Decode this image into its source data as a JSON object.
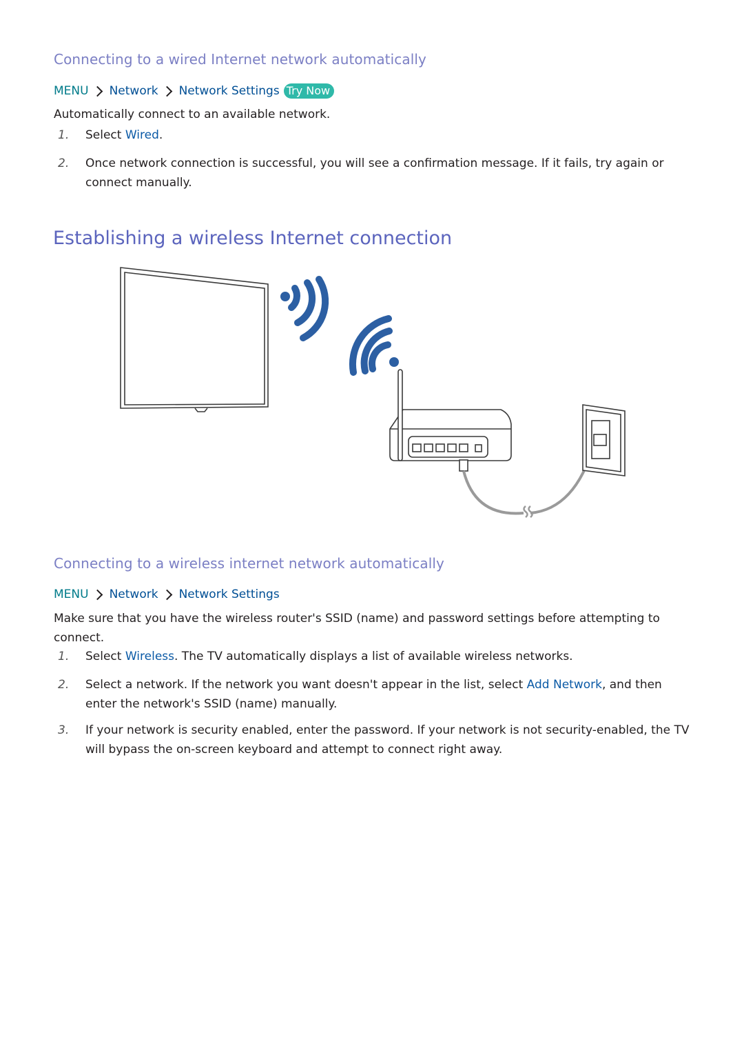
{
  "section_wired": {
    "heading": "Connecting to a wired Internet network automatically",
    "path": {
      "menu": "MENU",
      "crumbs": [
        "Network",
        "Network Settings"
      ],
      "badge": "Try Now"
    },
    "intro": "Automatically connect to an available network.",
    "steps": [
      {
        "num": "1.",
        "pre": "Select ",
        "kw": "Wired",
        "post": "."
      },
      {
        "num": "2.",
        "text": "Once network connection is successful, you will see a confirmation message. If it fails, try again or connect manually."
      }
    ]
  },
  "section_wireless": {
    "title": "Establishing a wireless Internet connection",
    "illustration": {
      "items": [
        "tv",
        "wifi-signal-from-tv",
        "wifi-signal-from-router",
        "wireless-router",
        "wall-lan-port",
        "lan-cable"
      ]
    },
    "subheading": "Connecting to a wireless internet network automatically",
    "path": {
      "menu": "MENU",
      "crumbs": [
        "Network",
        "Network Settings"
      ]
    },
    "intro": "Make sure that you have the wireless router's SSID (name) and password settings before attempting to connect.",
    "steps": [
      {
        "num": "1.",
        "pre": "Select ",
        "kw": "Wireless",
        "post": ". The TV automatically displays a list of available wireless networks."
      },
      {
        "num": "2.",
        "pre": "Select a network. If the network you want doesn't appear in the list, select ",
        "kw": "Add Network",
        "post": ", and then enter the network's SSID (name) manually."
      },
      {
        "num": "3.",
        "text": "If your network is security enabled, enter the password. If your network is not security-enabled, the TV will bypass the on-screen keyboard and attempt to connect right away."
      }
    ]
  },
  "colors": {
    "heading": "#7b7fc4",
    "title": "#5b64bd",
    "keyword": "#0b5aa6",
    "menu": "#007b8a",
    "badge": "#2fb9a9",
    "wifi": "#2c5fa3"
  }
}
